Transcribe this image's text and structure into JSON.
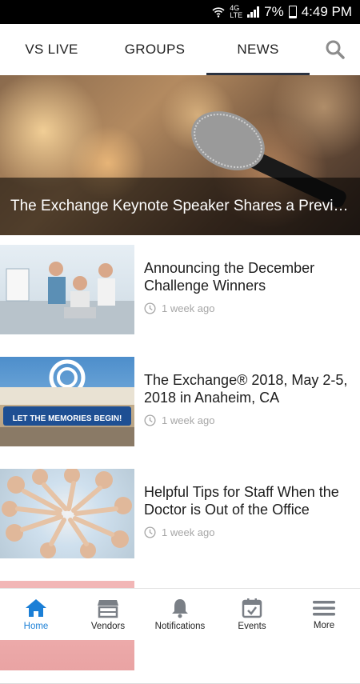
{
  "status_bar": {
    "battery": "7%",
    "time": "4:49 PM",
    "network_label": "4G\nLTE"
  },
  "tabs": [
    {
      "label": "VS LIVE",
      "active": false
    },
    {
      "label": "GROUPS",
      "active": false
    },
    {
      "label": "NEWS",
      "active": true
    }
  ],
  "search_icon": "search-icon",
  "hero": {
    "title": "The Exchange Keynote Speaker Shares a Previe…"
  },
  "news": [
    {
      "title": "Announcing the December Challenge Winners",
      "time": "1 week ago"
    },
    {
      "title": "The Exchange® 2018, May 2-5, 2018 in Anaheim, CA",
      "time": "1 week ago"
    },
    {
      "title": "Helpful Tips for Staff When the Doctor is Out of the Office",
      "time": "1 week ago"
    }
  ],
  "bottom_nav": [
    {
      "label": "Home",
      "icon": "home-icon",
      "active": true
    },
    {
      "label": "Vendors",
      "icon": "store-icon",
      "active": false
    },
    {
      "label": "Notifications",
      "icon": "bell-icon",
      "active": false
    },
    {
      "label": "Events",
      "icon": "calendar-icon",
      "active": false
    },
    {
      "label": "More",
      "icon": "menu-icon",
      "active": false
    }
  ],
  "colors": {
    "accent": "#1b7fd6",
    "tab_underline": "#2b3240",
    "muted_text": "#a6a6a6"
  }
}
